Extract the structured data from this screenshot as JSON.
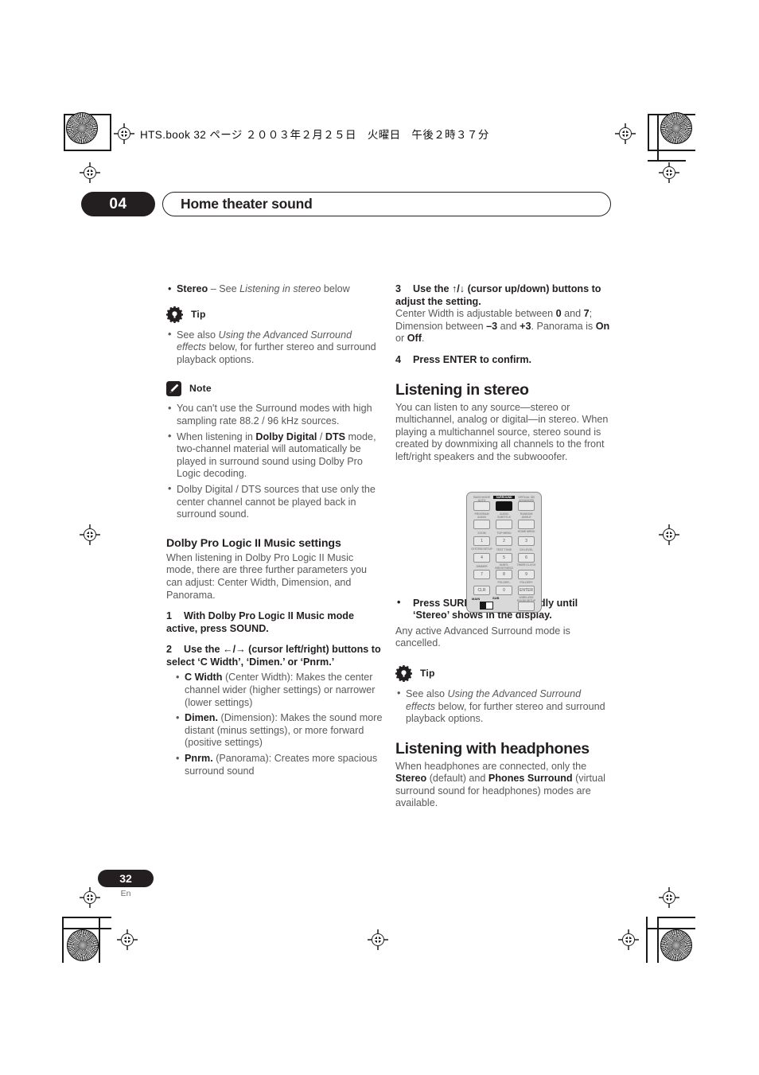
{
  "document": {
    "file_header": "HTS.book  32 ページ  ２００３年２月２５日　火曜日　午後２時３７分",
    "chapter_number": "04",
    "chapter_title": "Home theater sound",
    "page_number": "32",
    "page_language": "En",
    "colors": {
      "ink": "#231f20",
      "body_text": "#58595b",
      "rule": "#231f20"
    }
  },
  "left_column": {
    "stereo_bullet": {
      "term": "Stereo",
      "dash": " – ",
      "lead": "See ",
      "italic_ref": "Listening in stereo",
      "tail": " below"
    },
    "tip_1": {
      "icon": "gear-icon",
      "label": "Tip",
      "bullet": {
        "lead": "See also ",
        "italic_ref": "Using the Advanced Surround effects",
        "tail": " below, for further stereo and surround playback options."
      }
    },
    "note_1": {
      "icon": "pencil-icon",
      "label": "Note",
      "bullets": [
        {
          "parts": [
            {
              "text": "You can't use the Surround modes with high sampling rate 88.2 / 96 kHz sources.",
              "style": "normal"
            }
          ]
        },
        {
          "parts": [
            {
              "text": "When listening in ",
              "style": "normal"
            },
            {
              "text": "Dolby Digital",
              "style": "bold"
            },
            {
              "text": " / ",
              "style": "normal"
            },
            {
              "text": "DTS",
              "style": "bold"
            },
            {
              "text": " mode, two-channel material will automatically be played in surround sound using Dolby Pro Logic decoding.",
              "style": "normal"
            }
          ]
        },
        {
          "parts": [
            {
              "text": "Dolby Digital / DTS sources that use only the center channel cannot be played back in surround sound.",
              "style": "normal"
            }
          ]
        }
      ]
    },
    "section_dplii": {
      "heading": "Dolby Pro Logic II Music settings",
      "intro": "When listening in Dolby Pro Logic II Music mode, there are three further parameters you can adjust: Center Width, Dimension, and Panorama.",
      "steps": [
        {
          "num": "1",
          "text": "With Dolby Pro Logic II Music mode active, press SOUND."
        },
        {
          "num": "2",
          "text_before_icons": "Use the ",
          "icons": "←/→",
          "text_after_icons": " (cursor left/right) buttons to select ‘C Width’, ‘Dimen.’ or ‘Pnrm.’"
        }
      ],
      "parameter_bullets": [
        {
          "term": "C Width",
          "desc": " (Center Width): Makes the center channel wider (higher settings) or narrower (lower settings)"
        },
        {
          "term": "Dimen.",
          "desc": " (Dimension): Makes the sound more distant (minus settings), or more forward (positive settings)"
        },
        {
          "term": "Pnrm.",
          "desc": " (Panorama): Creates more spacious surround sound"
        }
      ]
    }
  },
  "right_column": {
    "steps": [
      {
        "num": "3",
        "text_before_icons": "Use the ",
        "icons": "↑/↓",
        "text_after_icons": " (cursor up/down) buttons to adjust the setting."
      },
      {
        "num": "4",
        "text": "Press ENTER to confirm."
      }
    ],
    "step3_body": {
      "parts": [
        {
          "text": "Center Width is adjustable between ",
          "style": "normal"
        },
        {
          "text": "0",
          "style": "bold"
        },
        {
          "text": " and ",
          "style": "normal"
        },
        {
          "text": "7",
          "style": "bold"
        },
        {
          "text": "; Dimension between ",
          "style": "normal"
        },
        {
          "text": "–3",
          "style": "bold"
        },
        {
          "text": " and ",
          "style": "normal"
        },
        {
          "text": "+3",
          "style": "bold"
        },
        {
          "text": ". Panorama is ",
          "style": "normal"
        },
        {
          "text": "On",
          "style": "bold"
        },
        {
          "text": " or ",
          "style": "normal"
        },
        {
          "text": "Off",
          "style": "bold"
        },
        {
          "text": ".",
          "style": "normal"
        }
      ]
    },
    "section_stereo": {
      "heading": "Listening in stereo",
      "body": "You can listen to any source—stereo or multichannel, analog or digital—in stereo. When playing a multichannel source, stereo sound is created by downmixing all channels to the front left/right speakers and the subwooofer.",
      "instruction_bullet": "Press SURROUND repeatedly until ‘Stereo’ shows in the display.",
      "instruction_body": "Any active Advanced Surround mode is cancelled."
    },
    "tip_2": {
      "icon": "gear-icon",
      "label": "Tip",
      "bullet": {
        "lead": "See also ",
        "italic_ref": "Using the Advanced Surround effects",
        "tail": " below, for further stereo and surround playback options."
      }
    },
    "section_headphones": {
      "heading": "Listening with headphones",
      "body_parts": [
        {
          "text": "When headphones are connected, only the ",
          "style": "normal"
        },
        {
          "text": "Stereo",
          "style": "bold"
        },
        {
          "text": " (default) and ",
          "style": "normal"
        },
        {
          "text": "Phones Surround",
          "style": "bold"
        },
        {
          "text": " (virtual surround sound for headphones) modes are available.",
          "style": "normal"
        }
      ]
    }
  },
  "remote_illustration": {
    "name": "remote-control-diagram",
    "highlighted_button": "SURROUND",
    "labels_row1": [
      "BASS MODE AUTO",
      "SURROUND",
      "VIRTUAL SB ADVANCED"
    ],
    "labels_row2": [
      "PROGRAM AUDIO",
      "AUDIO SUBTITLE",
      "RANDOM ANGLE"
    ],
    "labels_row3": [
      "ZOOM",
      "TOP MENU",
      "HOME MENU"
    ],
    "labels_row4": [
      "SYSTEM SETUP",
      "TEST TONE",
      "CH LEVEL"
    ],
    "labels_row5": [
      "DIMMER",
      "SUBTL BRIGHTNESS",
      "TIMER CLOCK"
    ],
    "labels_row6": [
      "",
      "FOLDER–",
      "FOLDER+"
    ],
    "keys_row3": [
      "1",
      "2",
      "3"
    ],
    "keys_row4": [
      "4",
      "5",
      "6"
    ],
    "keys_row5": [
      "7",
      "8",
      "9"
    ],
    "keys_row6": [
      "CLR",
      "0",
      "ENTER"
    ],
    "label_wireless": "WIRELESS ROOM SETUP",
    "switch_left": "MAIN",
    "switch_right": "SUB"
  }
}
